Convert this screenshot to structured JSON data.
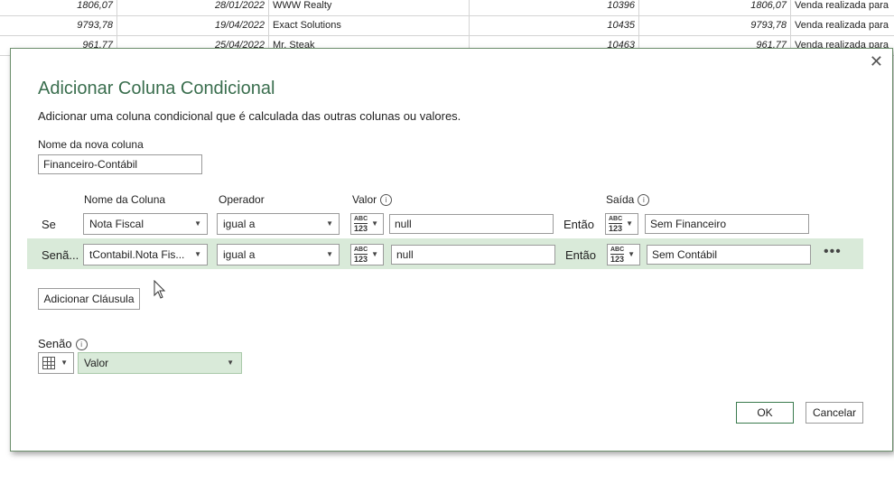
{
  "background_sheet": {
    "rows": [
      [
        "1806,07",
        "28/01/2022",
        "WWW Realty",
        "10396",
        "1806,07",
        "Venda realizada para"
      ],
      [
        "9793,78",
        "19/04/2022",
        "Exact Solutions",
        "10435",
        "9793,78",
        "Venda realizada para"
      ],
      [
        "961,77",
        "25/04/2022",
        "Mr. Steak",
        "10463",
        "961,77",
        "Venda realizada para"
      ]
    ]
  },
  "dialog": {
    "close_label": "✕",
    "title": "Adicionar Coluna Condicional",
    "description": "Adicionar uma coluna condicional que é calculada das outras colunas ou valores.",
    "new_column_label": "Nome da nova coluna",
    "new_column_value": "Financeiro-Contábil",
    "headers": {
      "column_name": "Nome da Coluna",
      "operator": "Operador",
      "value": "Valor",
      "output": "Saída"
    },
    "type_icon": {
      "top": "ABC",
      "bottom": "123"
    },
    "clauses": [
      {
        "prefix": "Se",
        "column": "Nota Fiscal",
        "operator": "igual a",
        "value": "null",
        "then": "Então",
        "output": "Sem Financeiro"
      },
      {
        "prefix": "Senã...",
        "column": "tContabil.Nota Fis...",
        "operator": "igual a",
        "value": "null",
        "then": "Então",
        "output": "Sem Contábil"
      }
    ],
    "more_options": "•••",
    "add_clause_button": "Adicionar Cláusula",
    "else_label": "Senão",
    "else_value": "Valor",
    "ok_button": "OK",
    "cancel_button": "Cancelar",
    "info_glyph": "i"
  },
  "colors": {
    "accent_green": "#3a6e4e",
    "row_highlight": "#d9ead9"
  }
}
